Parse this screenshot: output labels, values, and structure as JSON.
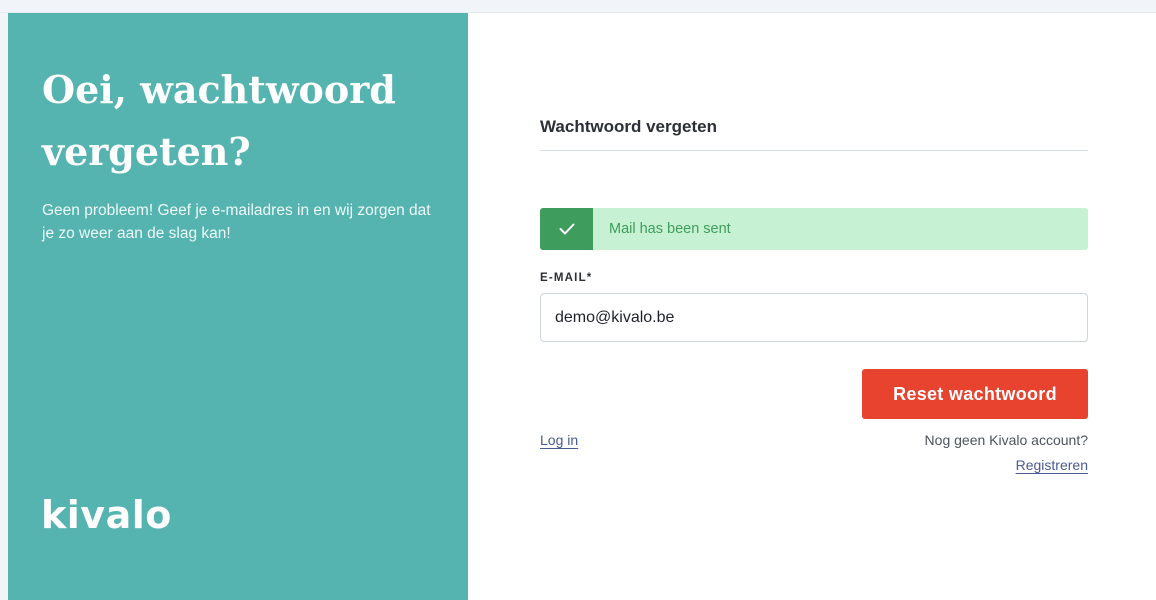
{
  "intro": {
    "title": "Oei, wachtwoord vergeten?",
    "subtitle": "Geen probleem! Geef je e-mailadres in en wij zorgen dat je zo weer aan de slag kan!",
    "logo_text": "kivalo"
  },
  "form": {
    "title": "Wachtwoord vergeten",
    "alert": {
      "icon": "check-icon",
      "message": "Mail has been sent",
      "color": "#3e9d5c",
      "background": "#c6f2d3"
    },
    "email_label": "E-MAIL*",
    "email_value": "demo@kivalo.be",
    "submit_label": "Reset wachtwoord",
    "login_link": "Log in",
    "no_account_text": "Nog geen Kivalo account?",
    "register_link": "Registreren"
  },
  "colors": {
    "panel": "#55b3b0",
    "accent": "#e7432f",
    "link": "#4a5a93"
  }
}
